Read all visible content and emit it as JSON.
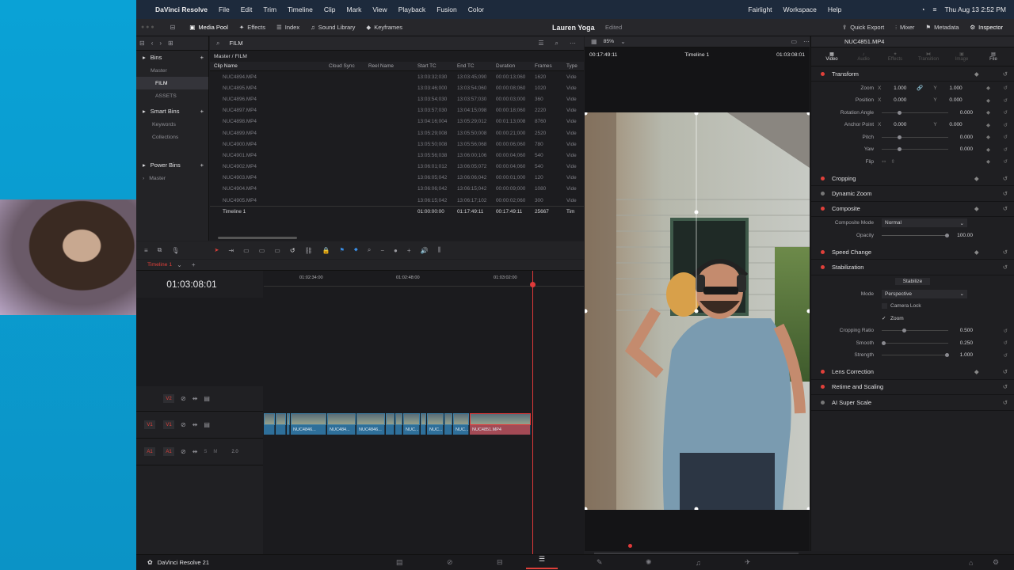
{
  "menubar": {
    "app": "DaVinci Resolve",
    "items": [
      "File",
      "Edit",
      "Trim",
      "Timeline",
      "Clip",
      "Mark",
      "View",
      "Playback",
      "Fusion",
      "Color",
      "Fairlight",
      "Workspace",
      "Help"
    ],
    "clock": "Thu Aug 13  2:52 PM"
  },
  "toolbar": {
    "media_pool": "Media Pool",
    "effects": "Effects",
    "index": "Index",
    "sound_library": "Sound Library",
    "keyframes": "Keyframes",
    "project": "Lauren Yoga",
    "status": "Edited",
    "quick_export": "Quick Export",
    "mixer": "Mixer",
    "metadata": "Metadata",
    "inspector": "Inspector"
  },
  "bins": {
    "header": "Bins",
    "items": [
      {
        "label": "Master"
      },
      {
        "label": "FILM"
      },
      {
        "label": "ASSETS"
      }
    ],
    "smart_bins": "Smart Bins",
    "smart_items": [
      {
        "label": "Keywords"
      },
      {
        "label": "Collections"
      }
    ],
    "power_bins": "Power Bins",
    "power_items": [
      {
        "label": "Master"
      }
    ]
  },
  "mediapool": {
    "current_bin": "FILM",
    "path": "Master / FILM",
    "columns": [
      "Clip Name",
      "Cloud Sync",
      "Reel Name",
      "Start TC",
      "End TC",
      "Duration",
      "Frames",
      "Type"
    ],
    "rows": [
      {
        "name": "NUC4894.MP4",
        "start": "13:03:32;030",
        "end": "13:03:45;090",
        "dur": "00:00:13;060",
        "frames": "1620",
        "type": "Vide"
      },
      {
        "name": "NUC4895.MP4",
        "start": "13:03:46;000",
        "end": "13:03:54;060",
        "dur": "00:00:08;060",
        "frames": "1020",
        "type": "Vide"
      },
      {
        "name": "NUC4896.MP4",
        "start": "13:03:54;030",
        "end": "13:03:57;030",
        "dur": "00:00:03;000",
        "frames": "360",
        "type": "Vide"
      },
      {
        "name": "NUC4897.MP4",
        "start": "13:03:57;030",
        "end": "13:04:15;098",
        "dur": "00:00:18;060",
        "frames": "2220",
        "type": "Vide"
      },
      {
        "name": "NUC4898.MP4",
        "start": "13:04:16;004",
        "end": "13:05:29;012",
        "dur": "00:01:13;008",
        "frames": "8760",
        "type": "Vide"
      },
      {
        "name": "NUC4899.MP4",
        "start": "13:05:29;008",
        "end": "13:05:50;008",
        "dur": "00:00:21;000",
        "frames": "2520",
        "type": "Vide"
      },
      {
        "name": "NUC4900.MP4",
        "start": "13:05:50;008",
        "end": "13:05:56;068",
        "dur": "00:00:06;060",
        "frames": "780",
        "type": "Vide"
      },
      {
        "name": "NUC4901.MP4",
        "start": "13:05:56;038",
        "end": "13:06:00;106",
        "dur": "00:00:04;060",
        "frames": "540",
        "type": "Vide"
      },
      {
        "name": "NUC4902.MP4",
        "start": "13:06:01;012",
        "end": "13:06:05;072",
        "dur": "00:00:04;060",
        "frames": "540",
        "type": "Vide"
      },
      {
        "name": "NUC4903.MP4",
        "start": "13:06:05;042",
        "end": "13:06:06;042",
        "dur": "00:00:01;000",
        "frames": "120",
        "type": "Vide"
      },
      {
        "name": "NUC4904.MP4",
        "start": "13:06:06;042",
        "end": "13:06:15;042",
        "dur": "00:00:09;000",
        "frames": "1080",
        "type": "Vide"
      },
      {
        "name": "NUC4905.MP4",
        "start": "13:06:15;042",
        "end": "13:06:17;102",
        "dur": "00:00:02;060",
        "frames": "300",
        "type": "Vide"
      },
      {
        "name": "Timeline 1",
        "start": "01:00:00:00",
        "end": "01:17:49:11",
        "dur": "00:17:49:11",
        "frames": "25667",
        "type": "Tim"
      }
    ]
  },
  "timeline": {
    "tab": "Timeline 1",
    "timecode": "01:03:08:01",
    "ruler": [
      "01:02:34:00",
      "01:02:48:00",
      "01:03:02:00"
    ],
    "tracks": [
      {
        "label": "V2",
        "patch": ""
      },
      {
        "label": "V1",
        "patch": "V1"
      },
      {
        "label": "A1",
        "patch": "A1",
        "level": "2.0"
      }
    ],
    "clips": [
      {
        "label": ""
      },
      {
        "label": ""
      },
      {
        "label": "NUC..."
      },
      {
        "label": "NUC4846..."
      },
      {
        "label": "NUC484..."
      },
      {
        "label": "NUC4846..."
      },
      {
        "label": ""
      },
      {
        "label": ""
      },
      {
        "label": "NUC..."
      },
      {
        "label": ""
      },
      {
        "label": "NUC..."
      },
      {
        "label": ""
      },
      {
        "label": "NUC..."
      },
      {
        "label": "NUC4851.MP4"
      }
    ]
  },
  "viewer": {
    "zoom": "85%",
    "tc_left": "00:17:49:11",
    "timeline_name": "Timeline 1",
    "tc_right": "01:03:08:01"
  },
  "inspector": {
    "clip": "NUC4851.MP4",
    "tabs": [
      "Video",
      "Audio",
      "Effects",
      "Transition",
      "Image",
      "File"
    ],
    "transform": {
      "title": "Transform",
      "zoom_label": "Zoom",
      "zoom_x": "1.000",
      "zoom_y": "1.000",
      "position_label": "Position",
      "pos_x": "0.000",
      "pos_y": "0.000",
      "rotation_label": "Rotation Angle",
      "rotation": "0.000",
      "anchor_label": "Anchor Point",
      "anchor_x": "0.000",
      "anchor_y": "0.000",
      "pitch_label": "Pitch",
      "pitch": "0.000",
      "yaw_label": "Yaw",
      "yaw": "0.000",
      "flip_label": "Flip",
      "x": "X",
      "y": "Y"
    },
    "cropping": "Cropping",
    "dynamic_zoom": "Dynamic Zoom",
    "composite": {
      "title": "Composite",
      "mode_label": "Composite Mode",
      "mode": "Normal",
      "opacity_label": "Opacity",
      "opacity": "100.00"
    },
    "speed_change": "Speed Change",
    "stabilization": {
      "title": "Stabilization",
      "stabilize": "Stabilize",
      "mode_label": "Mode",
      "mode": "Perspective",
      "camera_lock": "Camera Lock",
      "zoom": "Zoom",
      "cropping_ratio_label": "Cropping Ratio",
      "cropping_ratio": "0.500",
      "smooth_label": "Smooth",
      "smooth": "0.250",
      "strength_label": "Strength",
      "strength": "1.000"
    },
    "lens_correction": "Lens Correction",
    "retime": "Retime and Scaling",
    "ai_super_scale": "AI Super Scale"
  },
  "footer": {
    "app": "DaVinci Resolve 21"
  },
  "colors": {
    "accent_red": "#e0403a",
    "clip_blue": "#2e6f9a",
    "playhead": "#e03a3a"
  }
}
